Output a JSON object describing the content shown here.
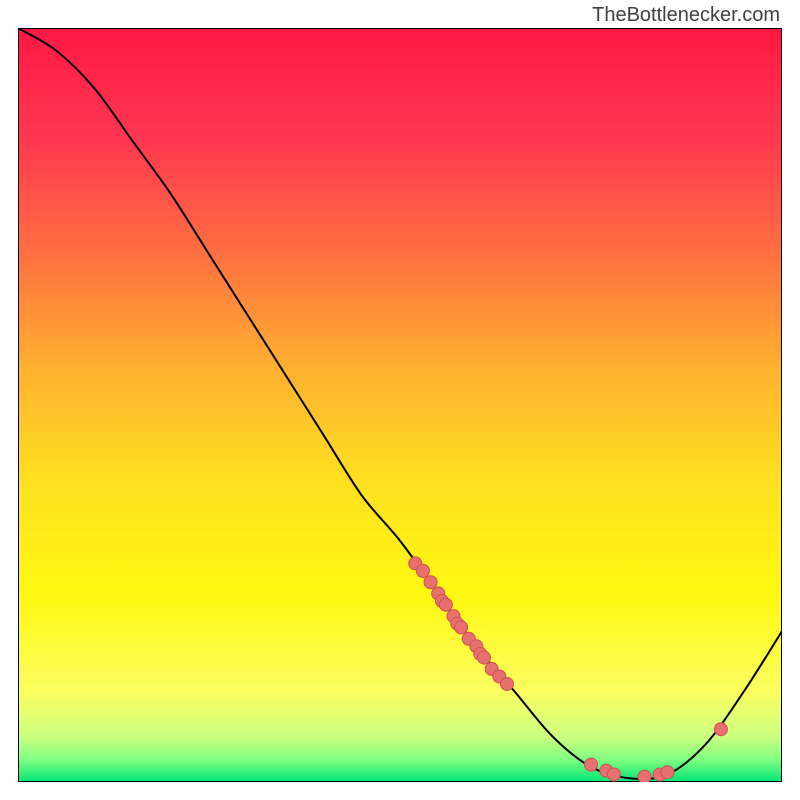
{
  "watermark": "TheBottlenecker.com",
  "chart_data": {
    "type": "line",
    "title": "",
    "xlabel": "",
    "ylabel": "",
    "xlim": [
      0,
      100
    ],
    "ylim": [
      0,
      100
    ],
    "curve": [
      {
        "x": 0,
        "y": 100
      },
      {
        "x": 5,
        "y": 97
      },
      {
        "x": 10,
        "y": 92
      },
      {
        "x": 15,
        "y": 85
      },
      {
        "x": 20,
        "y": 78
      },
      {
        "x": 25,
        "y": 70
      },
      {
        "x": 30,
        "y": 62
      },
      {
        "x": 35,
        "y": 54
      },
      {
        "x": 40,
        "y": 46
      },
      {
        "x": 45,
        "y": 38
      },
      {
        "x": 50,
        "y": 32
      },
      {
        "x": 55,
        "y": 25
      },
      {
        "x": 60,
        "y": 18
      },
      {
        "x": 65,
        "y": 12
      },
      {
        "x": 70,
        "y": 6
      },
      {
        "x": 75,
        "y": 2
      },
      {
        "x": 80,
        "y": 0.5
      },
      {
        "x": 85,
        "y": 1
      },
      {
        "x": 90,
        "y": 5
      },
      {
        "x": 95,
        "y": 12
      },
      {
        "x": 100,
        "y": 20
      }
    ],
    "scatter_points": [
      {
        "x": 52,
        "y": 29
      },
      {
        "x": 53,
        "y": 28
      },
      {
        "x": 54,
        "y": 26.5
      },
      {
        "x": 55,
        "y": 25
      },
      {
        "x": 55.5,
        "y": 24
      },
      {
        "x": 56,
        "y": 23.5
      },
      {
        "x": 57,
        "y": 22
      },
      {
        "x": 57.5,
        "y": 21
      },
      {
        "x": 58,
        "y": 20.5
      },
      {
        "x": 59,
        "y": 19
      },
      {
        "x": 60,
        "y": 18
      },
      {
        "x": 60.5,
        "y": 17
      },
      {
        "x": 61,
        "y": 16.5
      },
      {
        "x": 62,
        "y": 15
      },
      {
        "x": 63,
        "y": 14
      },
      {
        "x": 64,
        "y": 13
      },
      {
        "x": 75,
        "y": 2.3
      },
      {
        "x": 77,
        "y": 1.5
      },
      {
        "x": 78,
        "y": 1
      },
      {
        "x": 82,
        "y": 0.7
      },
      {
        "x": 84,
        "y": 1
      },
      {
        "x": 85,
        "y": 1.3
      },
      {
        "x": 92,
        "y": 7
      }
    ],
    "gradient_stops": [
      {
        "offset": 0,
        "color": "#ff1744"
      },
      {
        "offset": 15,
        "color": "#ff3850"
      },
      {
        "offset": 30,
        "color": "#ff7040"
      },
      {
        "offset": 45,
        "color": "#ffb030"
      },
      {
        "offset": 60,
        "color": "#ffe020"
      },
      {
        "offset": 75,
        "color": "#fff810"
      },
      {
        "offset": 88,
        "color": "#fcff60"
      },
      {
        "offset": 94,
        "color": "#ccff80"
      },
      {
        "offset": 97,
        "color": "#80ff80"
      },
      {
        "offset": 100,
        "color": "#00e676"
      }
    ],
    "point_color": "#e87070",
    "point_stroke": "#d05050"
  }
}
